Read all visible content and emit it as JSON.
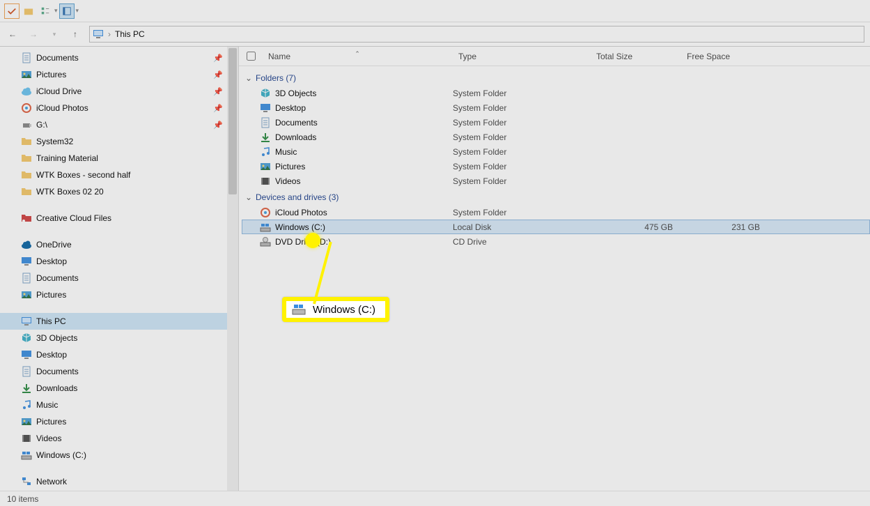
{
  "address": {
    "location": "This PC"
  },
  "columns": {
    "name": "Name",
    "type": "Type",
    "total_size": "Total Size",
    "free_space": "Free Space"
  },
  "sidebar": {
    "quick": [
      {
        "label": "Documents",
        "icon": "doc",
        "pinned": true
      },
      {
        "label": "Pictures",
        "icon": "pic",
        "pinned": true
      },
      {
        "label": "iCloud Drive",
        "icon": "icloud-drive",
        "pinned": true
      },
      {
        "label": "iCloud Photos",
        "icon": "icloud-photos",
        "pinned": true
      },
      {
        "label": "G:\\",
        "icon": "usb",
        "pinned": true
      },
      {
        "label": "System32",
        "icon": "folder",
        "pinned": false
      },
      {
        "label": "Training Material",
        "icon": "folder",
        "pinned": false
      },
      {
        "label": "WTK Boxes - second half",
        "icon": "folder",
        "pinned": false
      },
      {
        "label": "WTK Boxes 02 20",
        "icon": "folder",
        "pinned": false
      }
    ],
    "creative": {
      "label": "Creative Cloud Files"
    },
    "onedrive": {
      "label": "OneDrive"
    },
    "thispc": {
      "label": "This PC",
      "children": [
        {
          "label": "3D Objects",
          "icon": "3d"
        },
        {
          "label": "Desktop",
          "icon": "desktop"
        },
        {
          "label": "Documents",
          "icon": "doc"
        },
        {
          "label": "Downloads",
          "icon": "down"
        },
        {
          "label": "Music",
          "icon": "music"
        },
        {
          "label": "Pictures",
          "icon": "pic"
        },
        {
          "label": "Videos",
          "icon": "video"
        },
        {
          "label": "Windows (C:)",
          "icon": "drive"
        }
      ]
    },
    "network": {
      "label": "Network"
    }
  },
  "groups": {
    "folders": {
      "title": "Folders (7)",
      "items": [
        {
          "name": "3D Objects",
          "type": "System Folder",
          "icon": "3d"
        },
        {
          "name": "Desktop",
          "type": "System Folder",
          "icon": "desktop"
        },
        {
          "name": "Documents",
          "type": "System Folder",
          "icon": "doc"
        },
        {
          "name": "Downloads",
          "type": "System Folder",
          "icon": "down"
        },
        {
          "name": "Music",
          "type": "System Folder",
          "icon": "music"
        },
        {
          "name": "Pictures",
          "type": "System Folder",
          "icon": "pic"
        },
        {
          "name": "Videos",
          "type": "System Folder",
          "icon": "video"
        }
      ]
    },
    "drives": {
      "title": "Devices and drives (3)",
      "items": [
        {
          "name": "iCloud Photos",
          "type": "System Folder",
          "icon": "icloud-photos",
          "total": "",
          "free": ""
        },
        {
          "name": "Windows (C:)",
          "type": "Local Disk",
          "icon": "drive",
          "total": "475 GB",
          "free": "231 GB",
          "selected": true
        },
        {
          "name": "DVD      Drive (D:)",
          "type": "CD Drive",
          "icon": "dvd",
          "total": "",
          "free": ""
        }
      ]
    }
  },
  "callout": {
    "label": "Windows (C:)"
  },
  "status": {
    "text": "10 items"
  }
}
